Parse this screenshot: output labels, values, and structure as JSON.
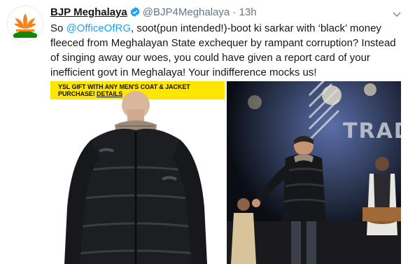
{
  "tweet": {
    "display_name": "BJP Meghalaya",
    "handle": "@BJP4Meghalaya",
    "separator": "·",
    "time": "13h",
    "text_segments": {
      "prefix": "So ",
      "mention": "@OfficeOfRG",
      "rest": ", soot(pun intended!)-boot ki sarkar with ‘black’ money fleeced from Meghalayan State exchequer by rampant corruption? Instead of singing away our woes, you could have given a report card of your inefficient govt in Meghalaya! Your indifference mocks us!"
    }
  },
  "media": {
    "ad_banner": {
      "line1": "YSL GIFT WITH ANY MEN'S COAT & JACKET",
      "line2_prefix": "PURCHASE! ",
      "line2_link": "DETAILS"
    },
    "stage_sign": "TRAD"
  },
  "icons": {
    "verified": "verified-badge-icon",
    "chevron": "chevron-down-icon",
    "logo": "bjp-lotus-logo"
  },
  "colors": {
    "accent": "#1da1f2",
    "muted": "#657786",
    "logo_saffron": "#f58220",
    "logo_green": "#138808",
    "ad_yellow": "#ffe600"
  }
}
